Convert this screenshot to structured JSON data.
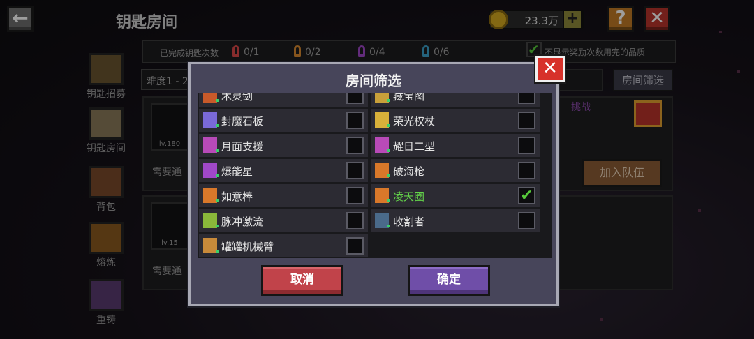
{
  "header": {
    "back_icon": "arrow-left-icon",
    "title": "钥匙房间",
    "currency_value": "23.3万",
    "help_label": "?",
    "close_label": "✕"
  },
  "sidebar": {
    "items": [
      {
        "label": "钥匙招募",
        "icon": "castle-icon"
      },
      {
        "label": "钥匙房间",
        "icon": "key-room-icon"
      },
      {
        "label": "背包",
        "icon": "backpack-icon"
      },
      {
        "label": "熔炼",
        "icon": "furnace-icon"
      },
      {
        "label": "重铸",
        "icon": "reforge-icon"
      }
    ]
  },
  "stats": {
    "label": "已完成钥匙次数",
    "counts": [
      {
        "value": "0/1",
        "color": "#d84848"
      },
      {
        "value": "0/2",
        "color": "#d88a30"
      },
      {
        "value": "0/4",
        "color": "#a048c8"
      },
      {
        "value": "0/6",
        "color": "#3aa0c8"
      }
    ],
    "show_label": "不显示奖励次数用完的品质"
  },
  "controls": {
    "difficulty": "难度1 - 2",
    "filter_button": "房间筛选"
  },
  "rooms": [
    {
      "level": "lv.180",
      "need": "需要通",
      "join": "加入队伍",
      "tag": "挑战"
    },
    {
      "level": "lv.15",
      "need": "需要通"
    }
  ],
  "modal": {
    "title": "房间筛选",
    "close_label": "✕",
    "cancel_label": "取消",
    "confirm_label": "确定",
    "items_left": [
      {
        "name": "木灵剑",
        "checked": false
      },
      {
        "name": "封魔石板",
        "checked": false
      },
      {
        "name": "月面支援",
        "checked": false
      },
      {
        "name": "爆能星",
        "checked": false
      },
      {
        "name": "如意棒",
        "checked": false
      },
      {
        "name": "脉冲激流",
        "checked": false
      },
      {
        "name": "罐罐机械臂",
        "checked": false
      }
    ],
    "items_right": [
      {
        "name": "藏宝图",
        "checked": false
      },
      {
        "name": "荣光权杖",
        "checked": false
      },
      {
        "name": "耀日二型",
        "checked": false
      },
      {
        "name": "破海枪",
        "checked": false
      },
      {
        "name": "凌天圈",
        "checked": true
      },
      {
        "name": "收割者",
        "checked": false
      }
    ],
    "checkmark": "✔"
  }
}
